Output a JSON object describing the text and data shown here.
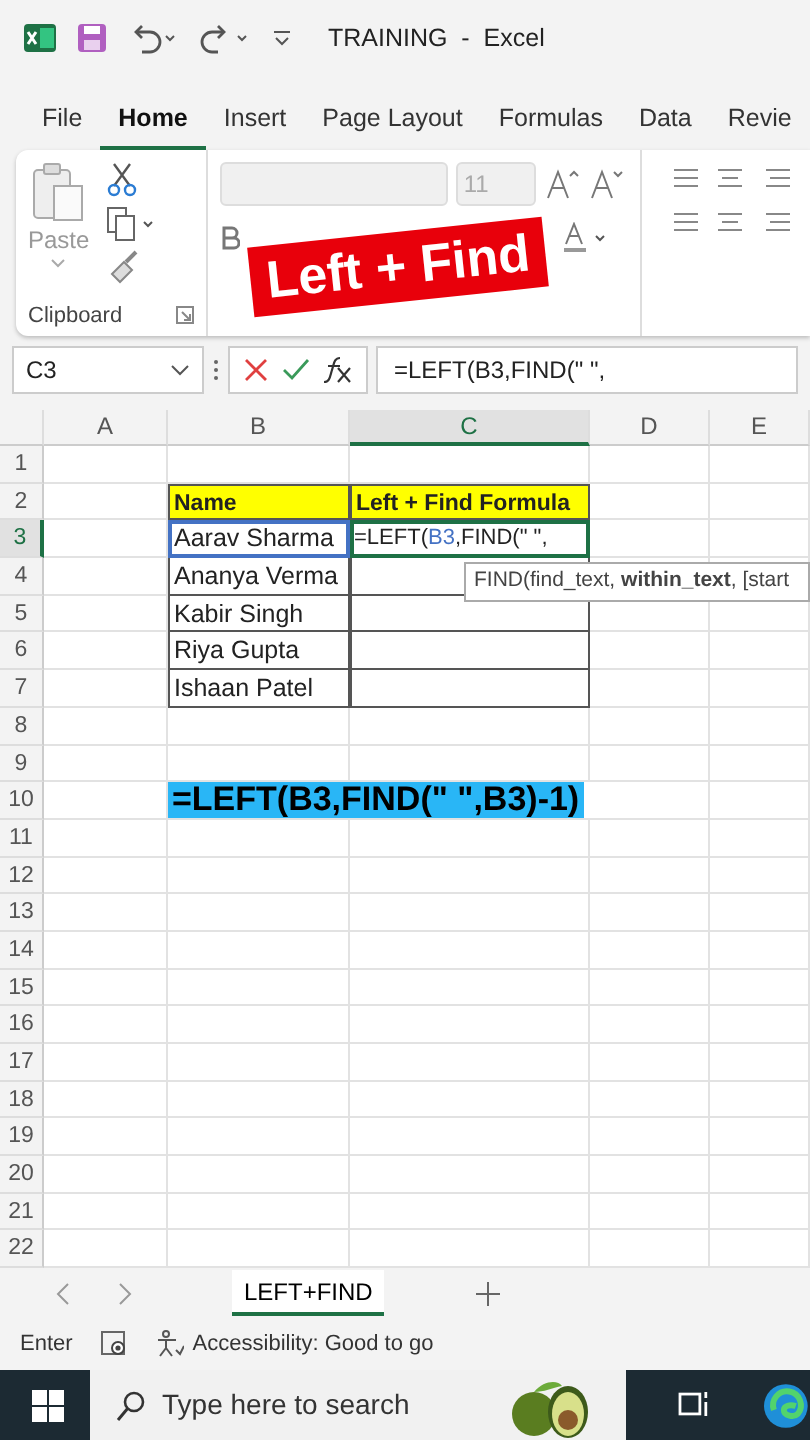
{
  "title_bar": {
    "title": "TRAINING  -  Excel"
  },
  "ribbon_tabs": [
    {
      "label": "File",
      "selected": false
    },
    {
      "label": "Home",
      "selected": true
    },
    {
      "label": "Insert",
      "selected": false
    },
    {
      "label": "Page Layout",
      "selected": false
    },
    {
      "label": "Formulas",
      "selected": false
    },
    {
      "label": "Data",
      "selected": false
    },
    {
      "label": "Revie",
      "selected": false
    }
  ],
  "ribbon": {
    "paste_label": "Paste",
    "clipboard_label": "Clipboard",
    "font_size": "11"
  },
  "overlay_label": "Left + Find",
  "formula_bar": {
    "name_box": "C3",
    "formula": "=LEFT(B3,FIND(\" \","
  },
  "columns": [
    {
      "label": "A",
      "selected": false
    },
    {
      "label": "B",
      "selected": false
    },
    {
      "label": "C",
      "selected": true
    },
    {
      "label": "D",
      "selected": false
    },
    {
      "label": "E",
      "selected": false
    }
  ],
  "rows": [
    {
      "number": "1",
      "selected": false,
      "cells": []
    },
    {
      "number": "2",
      "selected": false,
      "cells": [
        {
          "kind": "blank"
        },
        {
          "kind": "header",
          "text": "Name"
        },
        {
          "kind": "header",
          "text": "Left + Find Formula"
        }
      ]
    },
    {
      "number": "3",
      "selected": true,
      "cells": [
        {
          "kind": "blank"
        },
        {
          "kind": "data",
          "text": "Aarav Sharma",
          "referenced": true
        },
        {
          "kind": "editing",
          "parts": [
            {
              "text": "=LEFT(",
              "ref": false
            },
            {
              "text": "B3",
              "ref": true
            },
            {
              "text": ",FIND(\" \",",
              "ref": false
            }
          ]
        }
      ]
    },
    {
      "number": "4",
      "selected": false,
      "cells": [
        {
          "kind": "blank"
        },
        {
          "kind": "data",
          "text": "Ananya Verma",
          "referenced": false
        },
        {
          "kind": "data",
          "referenced": false
        }
      ]
    },
    {
      "number": "5",
      "selected": false,
      "cells": [
        {
          "kind": "blank"
        },
        {
          "kind": "data",
          "text": "Kabir Singh",
          "referenced": false
        },
        {
          "kind": "data",
          "referenced": false
        }
      ]
    },
    {
      "number": "6",
      "selected": false,
      "cells": [
        {
          "kind": "blank"
        },
        {
          "kind": "data",
          "text": "Riya Gupta",
          "referenced": false
        },
        {
          "kind": "data",
          "referenced": false
        }
      ]
    },
    {
      "number": "7",
      "selected": false,
      "cells": [
        {
          "kind": "blank"
        },
        {
          "kind": "data",
          "text": "Ishaan Patel",
          "referenced": false
        },
        {
          "kind": "data",
          "referenced": false
        }
      ]
    },
    {
      "number": "8",
      "selected": false,
      "cells": []
    },
    {
      "number": "9",
      "selected": false,
      "cells": []
    },
    {
      "number": "10",
      "selected": false,
      "cells": [
        {
          "kind": "blank"
        },
        {
          "kind": "callout",
          "text": "=LEFT(B3,FIND(\" \",B3)-1)"
        }
      ]
    },
    {
      "number": "11",
      "selected": false,
      "cells": []
    },
    {
      "number": "12",
      "selected": false,
      "cells": []
    },
    {
      "number": "13",
      "selected": false,
      "cells": []
    },
    {
      "number": "14",
      "selected": false,
      "cells": []
    },
    {
      "number": "15",
      "selected": false,
      "cells": []
    },
    {
      "number": "16",
      "selected": false,
      "cells": []
    },
    {
      "number": "17",
      "selected": false,
      "cells": []
    },
    {
      "number": "18",
      "selected": false,
      "cells": []
    },
    {
      "number": "19",
      "selected": false,
      "cells": []
    },
    {
      "number": "20",
      "selected": false,
      "cells": []
    },
    {
      "number": "21",
      "selected": false,
      "cells": []
    },
    {
      "number": "22",
      "selected": false,
      "cells": []
    }
  ],
  "tooltip": "FIND(find_text, **within_text**, [start",
  "sheet_tabs": [
    {
      "label": "LEFT+FIND",
      "selected": true
    }
  ],
  "status_bar": {
    "mode": "Enter",
    "accessibility": "Accessibility: Good to go"
  },
  "taskbar": {
    "search_placeholder": "Type here to search"
  }
}
